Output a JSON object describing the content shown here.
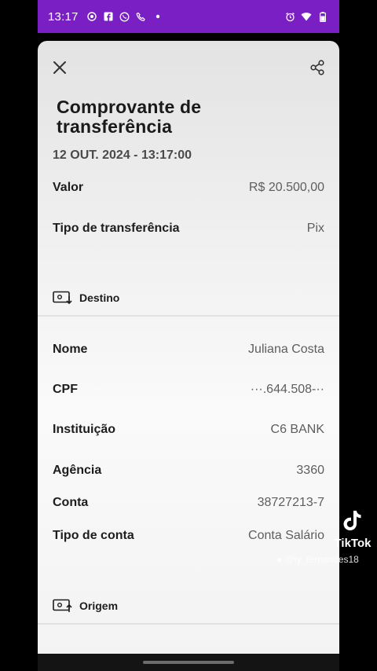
{
  "status_bar": {
    "time": "13:17",
    "left_icons": [
      "camera-dot-icon",
      "facebook-icon",
      "whatsapp-icon",
      "phone-icon",
      "dot-icon"
    ],
    "right_icons": [
      "alarm-icon",
      "wifi-icon",
      "battery-icon"
    ],
    "accent": "#7a1fc4"
  },
  "receipt": {
    "title": "Comprovante de transferência",
    "datetime": "12 OUT. 2024 - 13:17:00",
    "rows": [
      {
        "label": "Valor",
        "value": "R$ 20.500,00"
      },
      {
        "label": "Tipo de transferência",
        "value": "Pix"
      }
    ]
  },
  "destino": {
    "heading": "Destino",
    "rows": [
      {
        "label": "Nome",
        "value": "Juliana Costa"
      },
      {
        "label": "CPF",
        "value": "···.644.508-··"
      },
      {
        "label": "Instituição",
        "value": "C6 BANK"
      },
      {
        "label": "Agência",
        "value": "3360"
      },
      {
        "label": "Conta",
        "value": "38727213-7"
      },
      {
        "label": "Tipo de conta",
        "value": "Conta Salário"
      }
    ]
  },
  "origem": {
    "heading": "Origem"
  },
  "overlay": {
    "brand": "TikTok",
    "handle": "@ly_fernandes18"
  }
}
